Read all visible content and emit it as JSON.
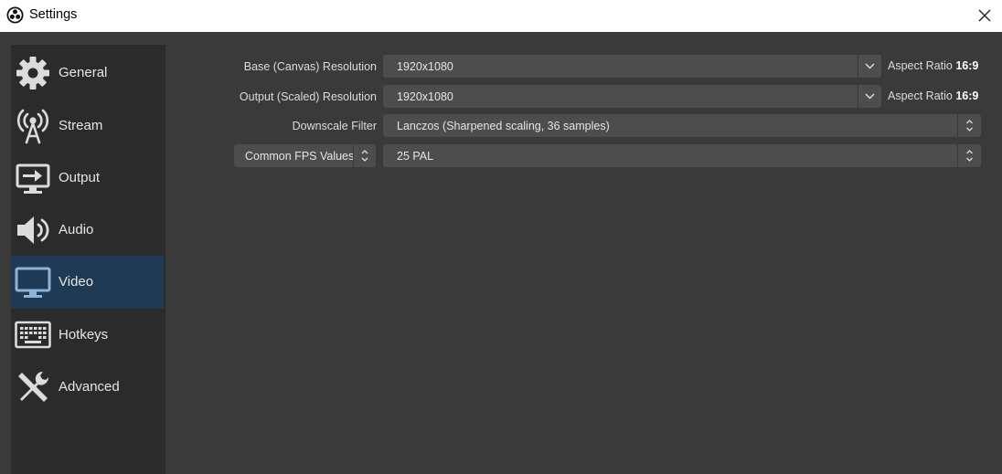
{
  "window": {
    "title": "Settings",
    "logo_icon": "obs-logo-icon",
    "close_icon": "close-icon"
  },
  "sidebar": {
    "items": [
      {
        "label": "General",
        "icon": "gear-icon",
        "active": false
      },
      {
        "label": "Stream",
        "icon": "antenna-icon",
        "active": false
      },
      {
        "label": "Output",
        "icon": "output-monitor-icon",
        "active": false
      },
      {
        "label": "Audio",
        "icon": "speaker-icon",
        "active": false
      },
      {
        "label": "Video",
        "icon": "monitor-icon",
        "active": true
      },
      {
        "label": "Hotkeys",
        "icon": "keyboard-icon",
        "active": false
      },
      {
        "label": "Advanced",
        "icon": "tools-icon",
        "active": false
      }
    ]
  },
  "video": {
    "base_resolution": {
      "label": "Base (Canvas) Resolution",
      "value": "1920x1080",
      "aspect_prefix": "Aspect Ratio",
      "aspect_value": "16:9"
    },
    "output_resolution": {
      "label": "Output (Scaled) Resolution",
      "value": "1920x1080",
      "aspect_prefix": "Aspect Ratio",
      "aspect_value": "16:9"
    },
    "downscale_filter": {
      "label": "Downscale Filter",
      "value": "Lanczos (Sharpened scaling, 36 samples)"
    },
    "fps": {
      "type_value": "Common FPS Values",
      "value": "25 PAL"
    }
  },
  "colors": {
    "background": "#3a3a3a",
    "sidebar": "#2b2b2b",
    "active_item": "#1e3a55",
    "control": "#4d4d4d",
    "text": "#e6e6e6"
  }
}
